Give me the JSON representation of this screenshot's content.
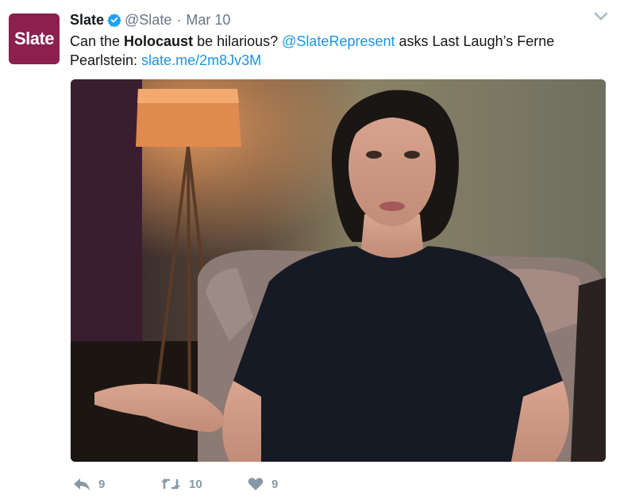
{
  "tweet": {
    "avatar_text": "Slate",
    "display_name": "Slate",
    "handle": "@Slate",
    "separator": "·",
    "date": "Mar 10",
    "text_parts": {
      "p1": "Can the ",
      "bold": "Holocaust",
      "p2": " be hilarious? ",
      "mention": "@SlateRepresent",
      "p3": " asks Last Laugh’s Ferne Pearlstein: ",
      "link": "slate.me/2m8Jv3M"
    },
    "colors": {
      "brand": "#8b1f4e",
      "link": "#1b95e0",
      "verified": "#1da1f2",
      "meta": "#657786",
      "action": "#8899a6"
    }
  },
  "actions": {
    "reply_count": "9",
    "retweet_count": "10",
    "like_count": "9"
  },
  "icons": {
    "verified": "verified-badge-icon",
    "caret": "chevron-down-icon",
    "reply": "reply-icon",
    "retweet": "retweet-icon",
    "like": "heart-icon"
  }
}
